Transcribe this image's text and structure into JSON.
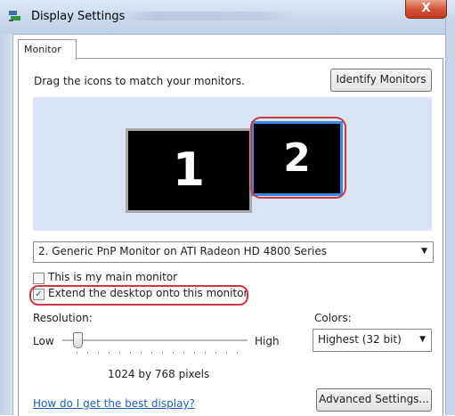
{
  "window": {
    "title": "Display Settings",
    "close_label": "X"
  },
  "tabs": [
    {
      "label": "Monitor"
    }
  ],
  "instruction": "Drag the icons to match your monitors.",
  "identify_button": "Identify Monitors",
  "monitors": [
    {
      "label": "1"
    },
    {
      "label": "2"
    }
  ],
  "monitor_select": {
    "value": "2. Generic PnP Monitor on ATI Radeon HD 4800 Series"
  },
  "checkboxes": {
    "main_monitor": {
      "label": "This is my main monitor",
      "checked": false
    },
    "extend_desktop": {
      "label": "Extend the desktop onto this monitor",
      "checked": true,
      "check_mark": "✓"
    }
  },
  "resolution": {
    "label": "Resolution:",
    "low": "Low",
    "high": "High",
    "value_text": "1024 by 768 pixels",
    "level": 0.07
  },
  "colors": {
    "label": "Colors:",
    "value": "Highest (32 bit)"
  },
  "help_link": "How do I get the best display?",
  "advanced_button": "Advanced Settings...",
  "icons": {
    "dropdown_arrow": "▼"
  },
  "accent_colors": {
    "highlight_red": "#d4343c",
    "selection_blue": "#3a8be8",
    "area_bg": "#d8e4f4"
  }
}
